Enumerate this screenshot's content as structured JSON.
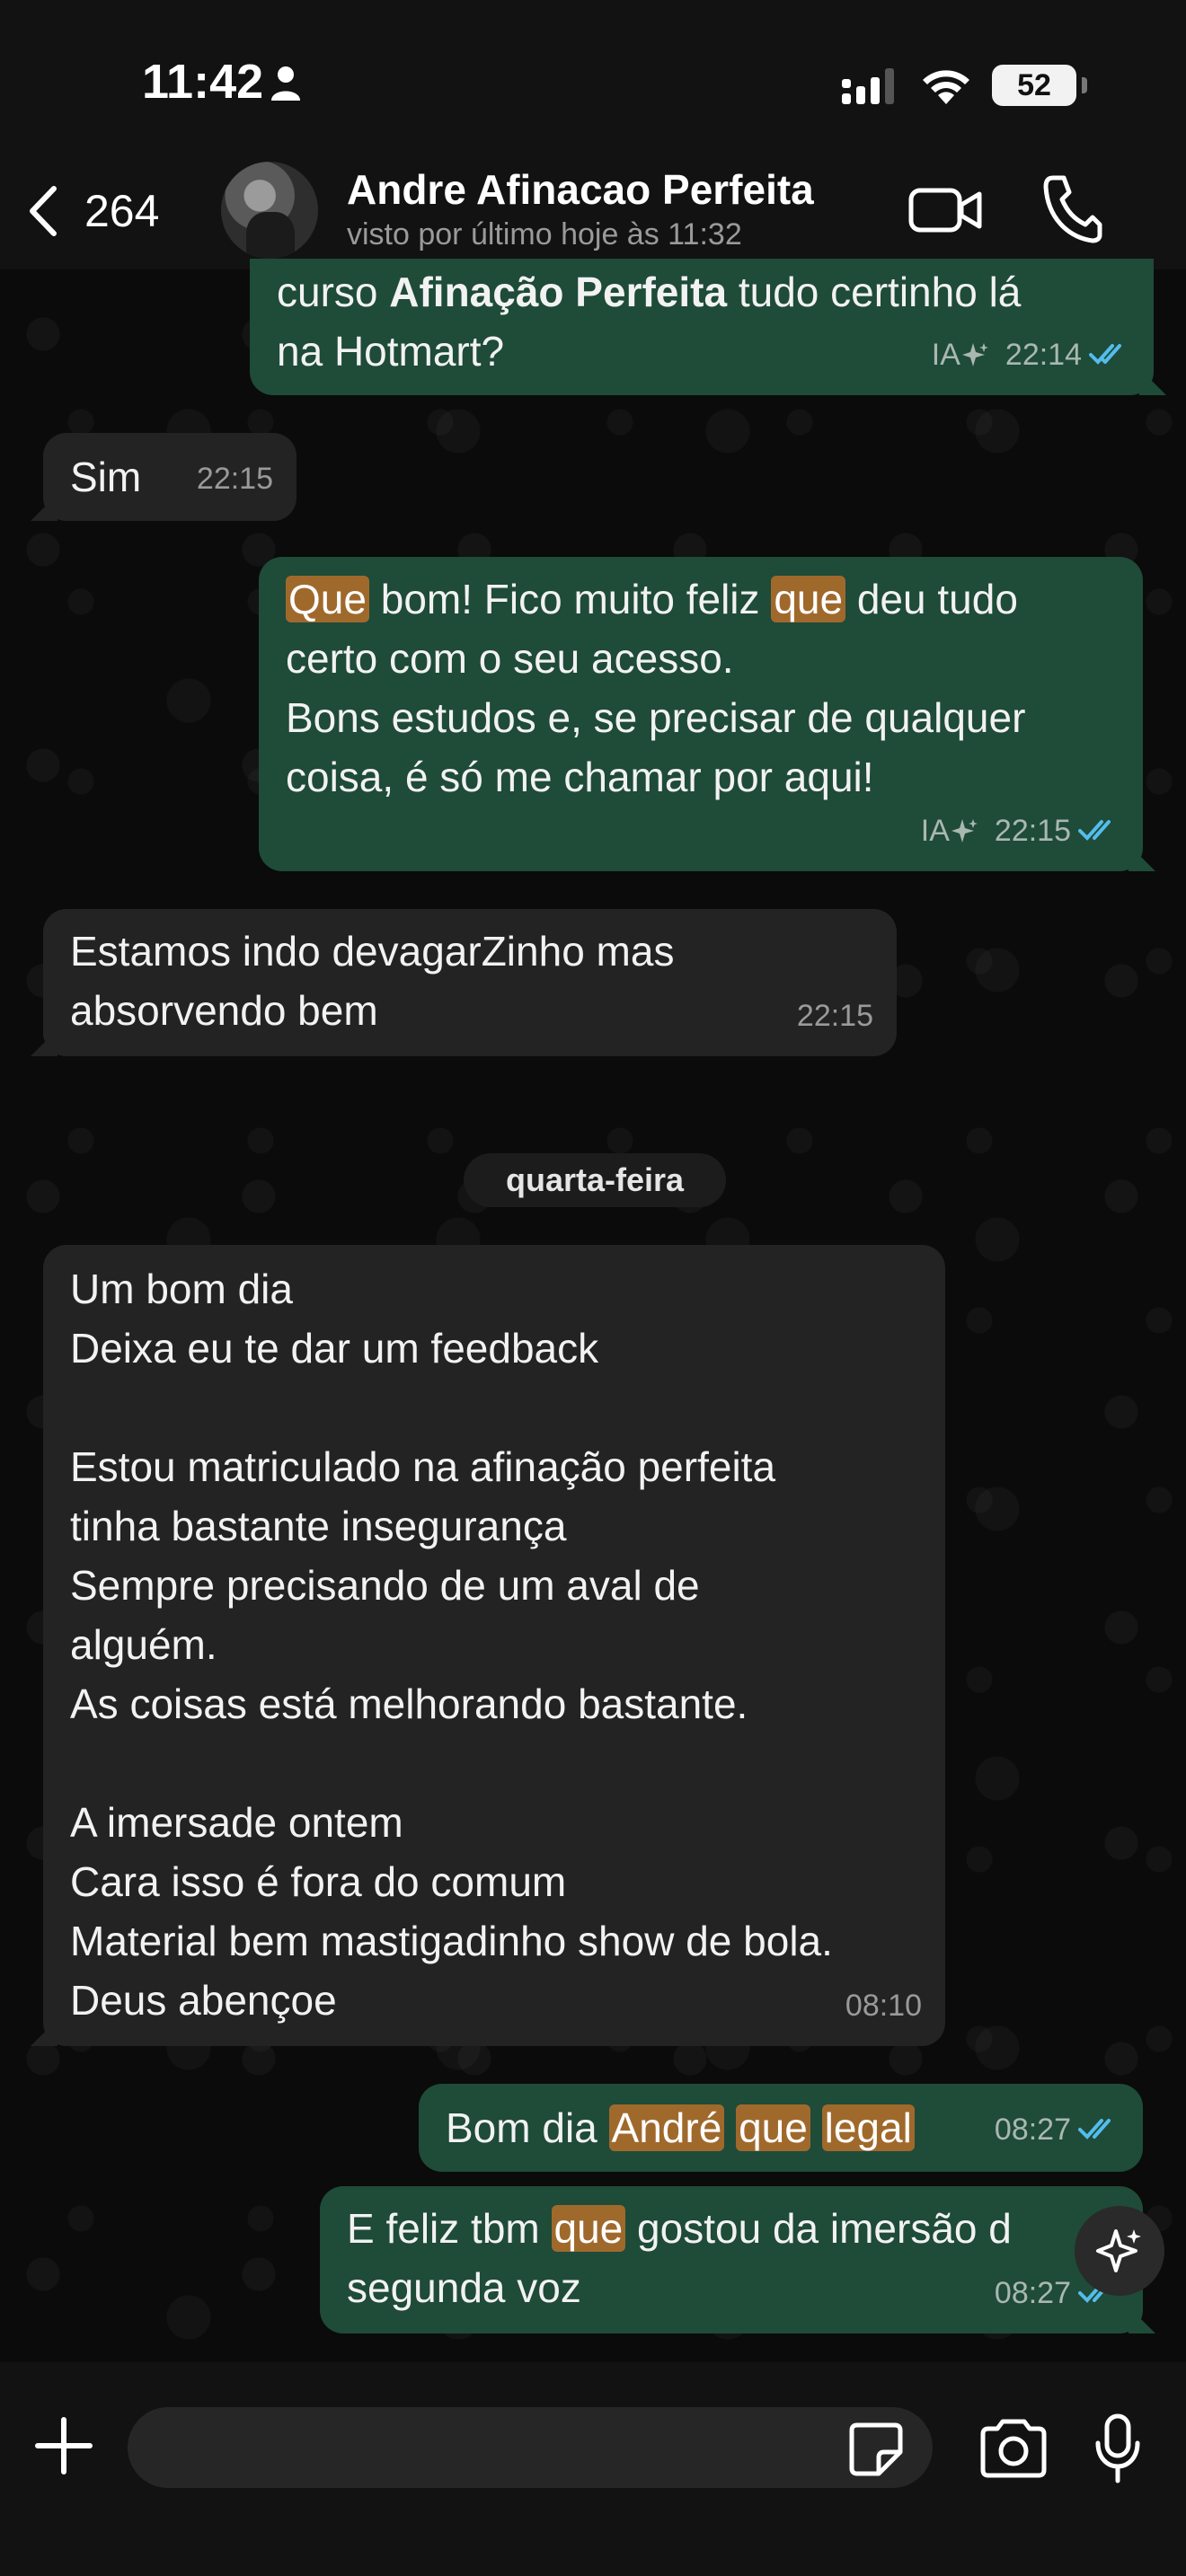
{
  "status_bar": {
    "time": "11:42",
    "battery": "52"
  },
  "header": {
    "back_count": "264",
    "contact_name": "Andre Afinacao Perfeita",
    "contact_status": "visto por último hoje às 11:32"
  },
  "messages": [
    {
      "direction": "out",
      "parts": [
        "curso ",
        "Afinação Perfeita",
        " tudo certinho lá\nna Hotmart?"
      ],
      "ai_label": "IA",
      "time": "22:14",
      "read": true
    },
    {
      "direction": "in",
      "text": "Sim",
      "time": "22:15"
    },
    {
      "direction": "out",
      "parts": [
        "Que",
        " bom! Fico muito feliz ",
        "que",
        " deu tudo\ncerto com o seu acesso.\nBons estudos e, se precisar de qualquer\ncoisa, é só me chamar por aqui!"
      ],
      "ai_label": "IA",
      "time": "22:15",
      "read": true
    },
    {
      "direction": "in",
      "text": "Estamos indo devagarZinho mas\nabsorvendo bem",
      "time": "22:15"
    },
    {
      "direction": "in",
      "text": "Um bom dia\nDeixa eu te dar um feedback\n\nEstou matriculado na afinação perfeita\ntinha bastante insegurança\nSempre precisando de um aval de\nalguém.\nAs coisas está melhorando bastante.\n\nA imersade ontem\nCara isso é fora do comum\nMaterial bem mastigadinho show de bola.\nDeus abençoe",
      "time": "08:10"
    },
    {
      "direction": "out",
      "parts": [
        "Bom dia ",
        "André",
        " ",
        "que",
        " ",
        "legal"
      ],
      "time": "08:27",
      "read": true
    },
    {
      "direction": "out",
      "parts": [
        "E feliz tbm ",
        "que",
        " gostou da imersão d",
        "\nsegunda voz"
      ],
      "time": "08:27",
      "read": true
    }
  ],
  "date_separator": "quarta-feira",
  "input": {
    "placeholder": ""
  },
  "colors": {
    "outgoing_bubble": "#1f4b39",
    "incoming_bubble": "#232324",
    "search_highlight": "#a0692c",
    "read_ticks": "#53bdeb"
  }
}
